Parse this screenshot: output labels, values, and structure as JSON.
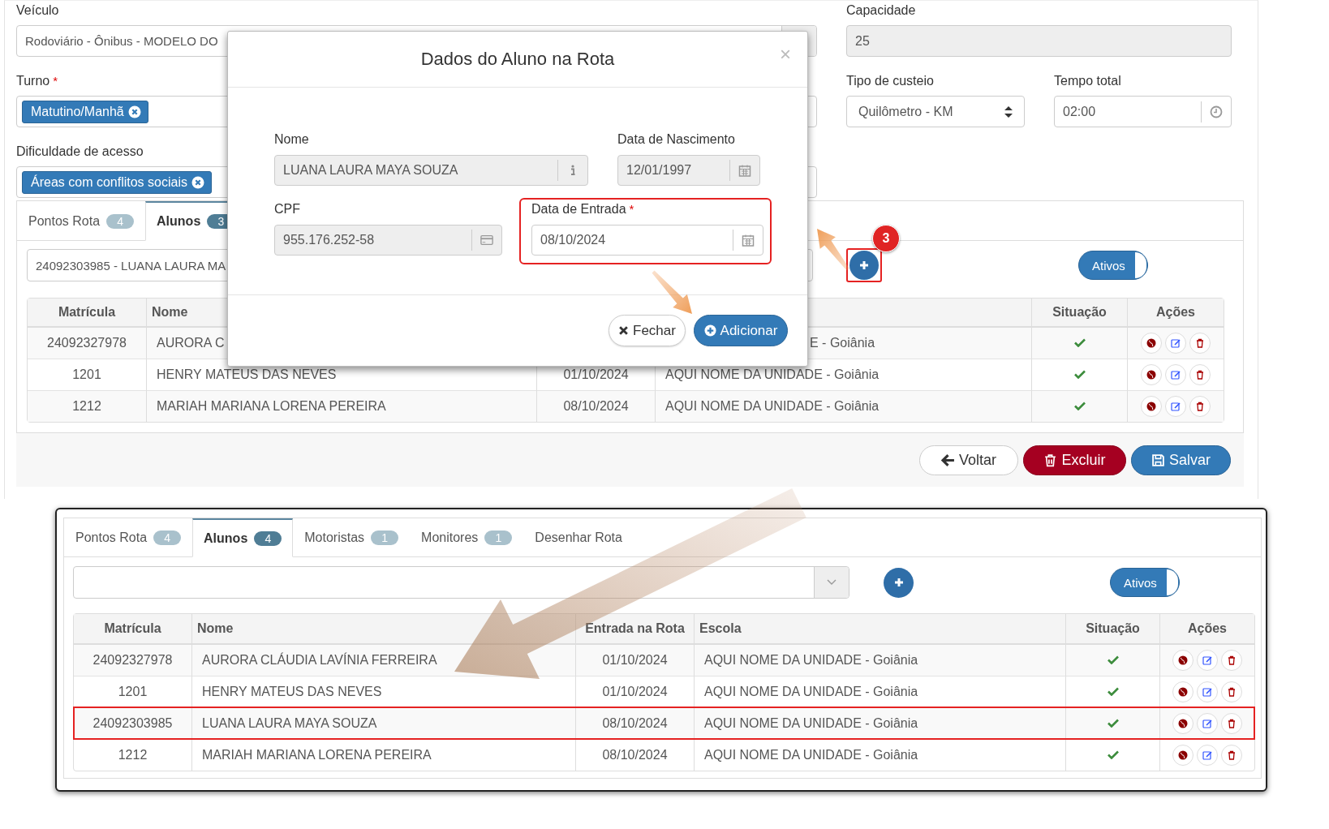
{
  "form": {
    "vehicle": {
      "label": "Veículo",
      "value": "Rodoviário - Ônibus - MODELO DO"
    },
    "shift": {
      "label": "Turno",
      "required_mark": "*",
      "tags": [
        "Matutino/Manhã"
      ]
    },
    "access_difficulty": {
      "label": "Dificuldade de acesso",
      "tags": [
        "Áreas com conflitos sociais"
      ]
    },
    "capacity": {
      "label": "Capacidade",
      "value": "25"
    },
    "cost_type": {
      "label": "Tipo de custeio",
      "value": "Quilômetro - KM"
    },
    "total_time": {
      "label": "Tempo total",
      "value": "02:00"
    }
  },
  "route_panel": {
    "tabs": [
      {
        "label": "Pontos Rota",
        "count": "4",
        "selected": false
      },
      {
        "label": "Alunos",
        "count": "3",
        "selected": true
      }
    ],
    "student_select": {
      "value": "24092303985 - LUANA LAURA MA"
    },
    "step_badge": "3",
    "toggle": {
      "label": "Ativos",
      "on": true
    },
    "table": {
      "columns": [
        {
          "label": "Matrícula"
        },
        {
          "label": "Nome"
        },
        {},
        {},
        {
          "label": "Situação"
        },
        {
          "label": "Ações"
        }
      ],
      "rows": [
        {
          "matricula": "24092327978",
          "nome": "AURORA C",
          "escola": "E - Goiânia",
          "active": true
        },
        {
          "matricula": "1201",
          "nome": "HENRY MATEUS DAS NEVES",
          "entrada": "01/10/2024",
          "escola": "AQUI NOME DA UNIDADE - Goiânia",
          "active": true
        },
        {
          "matricula": "1212",
          "nome": "MARIAH MARIANA LORENA PEREIRA",
          "entrada": "08/10/2024",
          "escola": "AQUI NOME DA UNIDADE - Goiânia",
          "active": true
        }
      ]
    }
  },
  "footer_buttons": [
    {
      "label": "Voltar",
      "kind": "back"
    },
    {
      "label": "Excluir",
      "kind": "delete"
    },
    {
      "label": "Salvar",
      "kind": "save"
    }
  ],
  "modal": {
    "title": "Dados do Aluno na Rota",
    "close": "×",
    "rows": [
      [
        {
          "label": "Nome",
          "value": "LUANA LAURA MAYA SOUZA",
          "kind": "info",
          "readonly": true,
          "highlighted": false
        },
        {
          "label": "Data de Nascimento",
          "value": "12/01/1997",
          "kind": "calendar",
          "readonly": true,
          "highlighted": false
        }
      ],
      [
        {
          "label": "CPF",
          "value": "955.176.252-58",
          "kind": "card",
          "readonly": true,
          "highlighted": false
        },
        {
          "label": "Data de Entrada",
          "required_mark": "*",
          "value": "08/10/2024",
          "kind": "calendar",
          "readonly": false,
          "highlighted": true
        }
      ]
    ],
    "buttons": [
      {
        "label": "Fechar",
        "kind": "close"
      },
      {
        "label": "Adicionar",
        "kind": "add"
      }
    ]
  },
  "inset": {
    "tabs": [
      {
        "label": "Pontos Rota",
        "count": "4",
        "selected": false
      },
      {
        "label": "Alunos",
        "count": "4",
        "selected": true
      },
      {
        "label": "Motoristas",
        "count": "1",
        "selected": false
      },
      {
        "label": "Monitores",
        "count": "1",
        "selected": false
      },
      {
        "label": "Desenhar Rota",
        "selected": false
      }
    ],
    "toggle": {
      "label": "Ativos",
      "on": true
    },
    "table": {
      "columns": [
        "Matrícula",
        "Nome",
        "Entrada na Rota",
        "Escola",
        "Situação",
        "Ações"
      ],
      "rows": [
        {
          "matricula": "24092327978",
          "nome": "AURORA CLÁUDIA LAVÍNIA FERREIRA",
          "entrada": "01/10/2024",
          "escola": "AQUI NOME DA UNIDADE - Goiânia",
          "active": true,
          "highlighted": false
        },
        {
          "matricula": "1201",
          "nome": "HENRY MATEUS DAS NEVES",
          "entrada": "01/10/2024",
          "escola": "AQUI NOME DA UNIDADE - Goiânia",
          "active": true,
          "highlighted": false
        },
        {
          "matricula": "24092303985",
          "nome": "LUANA LAURA MAYA SOUZA",
          "entrada": "08/10/2024",
          "escola": "AQUI NOME DA UNIDADE - Goiânia",
          "active": true,
          "highlighted": true
        },
        {
          "matricula": "1212",
          "nome": "MARIAH MARIANA LORENA PEREIRA",
          "entrada": "08/10/2024",
          "escola": "AQUI NOME DA UNIDADE - Goiânia",
          "active": true,
          "highlighted": false
        }
      ]
    }
  }
}
